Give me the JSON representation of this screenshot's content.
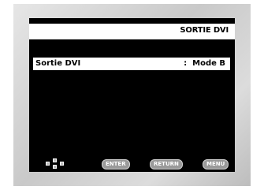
{
  "screen": {
    "title": "SORTIE DVI"
  },
  "menu": {
    "items": [
      {
        "label": "Sortie DVI",
        "value": ":  Mode B"
      }
    ]
  },
  "footer": {
    "nav_icon": "arrow-keys-icon",
    "buttons": [
      {
        "label": "ENTER"
      },
      {
        "label": "RETURN"
      },
      {
        "label": "MENU"
      }
    ]
  }
}
